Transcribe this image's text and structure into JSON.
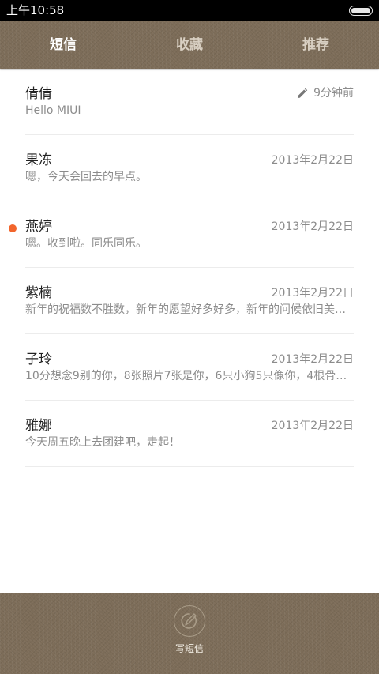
{
  "status_bar": {
    "time": "上午10:58"
  },
  "tabs": [
    {
      "label": "短信",
      "active": true
    },
    {
      "label": "收藏",
      "active": false
    },
    {
      "label": "推荐",
      "active": false
    }
  ],
  "conversations": [
    {
      "name": "倩倩",
      "preview": "Hello MIUI",
      "time": "9分钟前",
      "draft": true,
      "unread": false
    },
    {
      "name": "果冻",
      "preview": "嗯，今天会回去的早点。",
      "time": "2013年2月22日",
      "draft": false,
      "unread": false
    },
    {
      "name": "燕婷",
      "preview": "嗯。收到啦。同乐同乐。",
      "time": "2013年2月22日",
      "draft": false,
      "unread": true
    },
    {
      "name": "紫楠",
      "preview": "新年的祝福数不胜数，新年的愿望好多好多，新年的问候依旧美好...",
      "time": "2013年2月22日",
      "draft": false,
      "unread": false
    },
    {
      "name": "子玲",
      "preview": "10分想念9别的你，8张照片7张是你，6只小狗5只像你，4根骨头...",
      "time": "2013年2月22日",
      "draft": false,
      "unread": false
    },
    {
      "name": "雅娜",
      "preview": "今天周五晚上去团建吧，走起！",
      "time": "2013年2月22日",
      "draft": false,
      "unread": false
    }
  ],
  "compose": {
    "label": "写短信"
  },
  "colors": {
    "bar_brown": "#7c6c58",
    "unread_dot": "#f2652c",
    "secondary_text": "#8c8c8c"
  }
}
